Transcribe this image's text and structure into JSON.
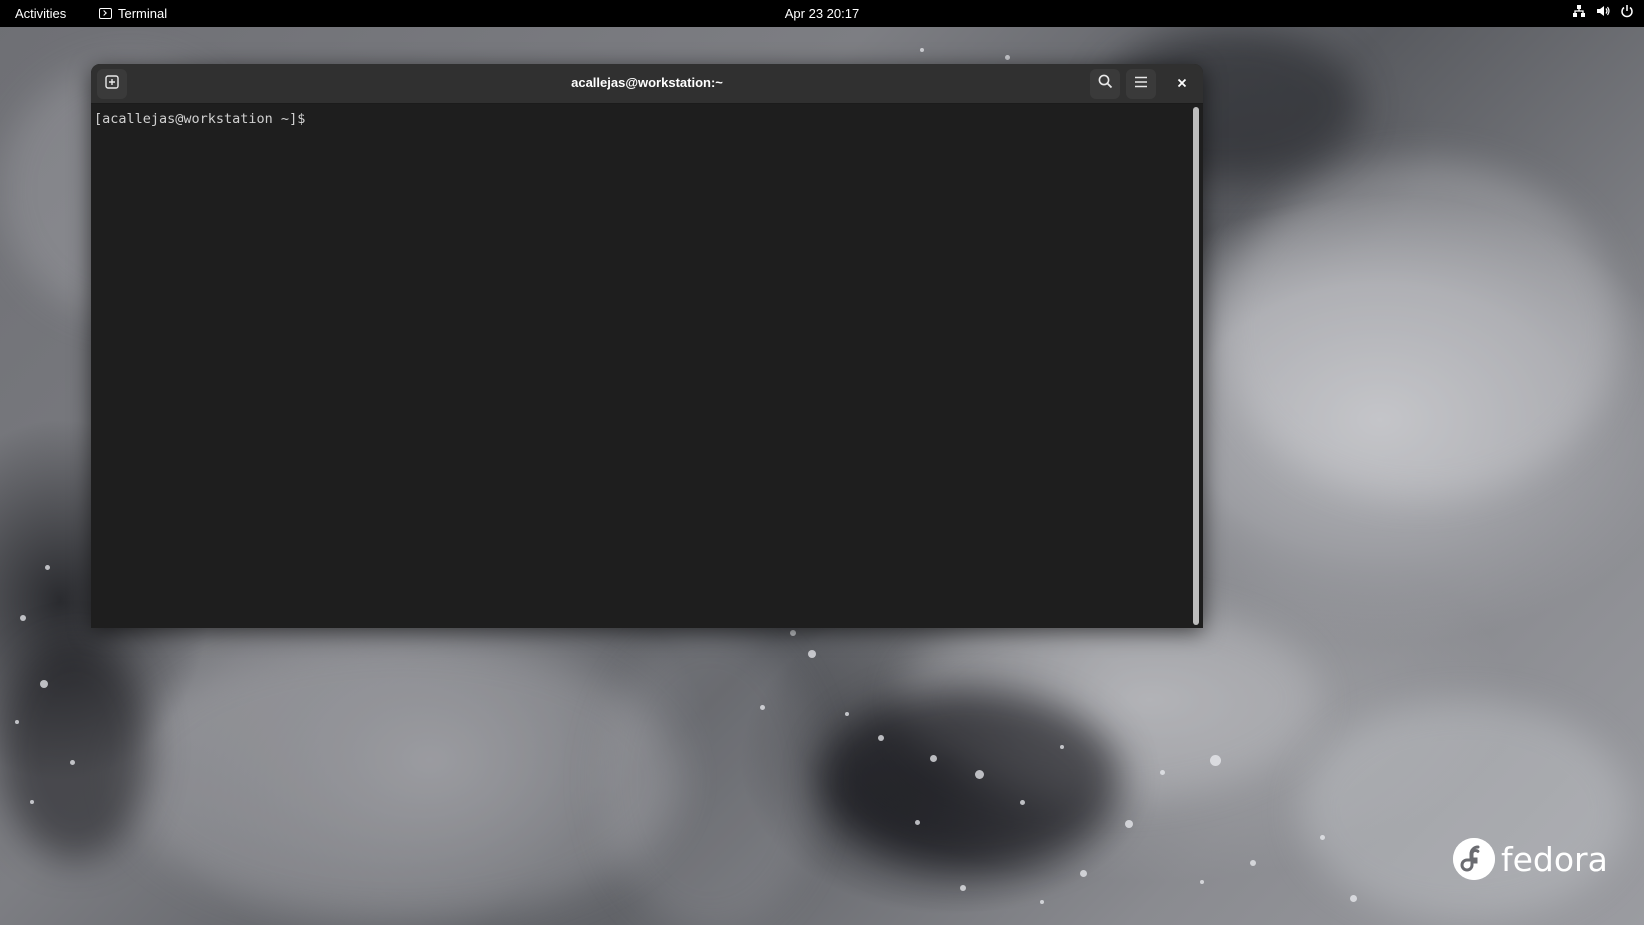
{
  "topbar": {
    "activities_label": "Activities",
    "app_name": "Terminal",
    "clock": "Apr 23  20:17",
    "status_icons": [
      "network-icon",
      "volume-icon",
      "power-icon"
    ]
  },
  "window": {
    "title": "acallejas@workstation:~",
    "prompt_text": "[acallejas@workstation ~]$",
    "buttons": [
      "new-tab-icon",
      "search-icon",
      "hamburger-menu-icon",
      "close-icon"
    ]
  },
  "desktop": {
    "logo_text": "fedora"
  },
  "colors": {
    "topbar_bg": "#000000",
    "terminal_bg": "#1e1e1e",
    "headerbar_bg": "#303030",
    "text": "#ffffff"
  }
}
